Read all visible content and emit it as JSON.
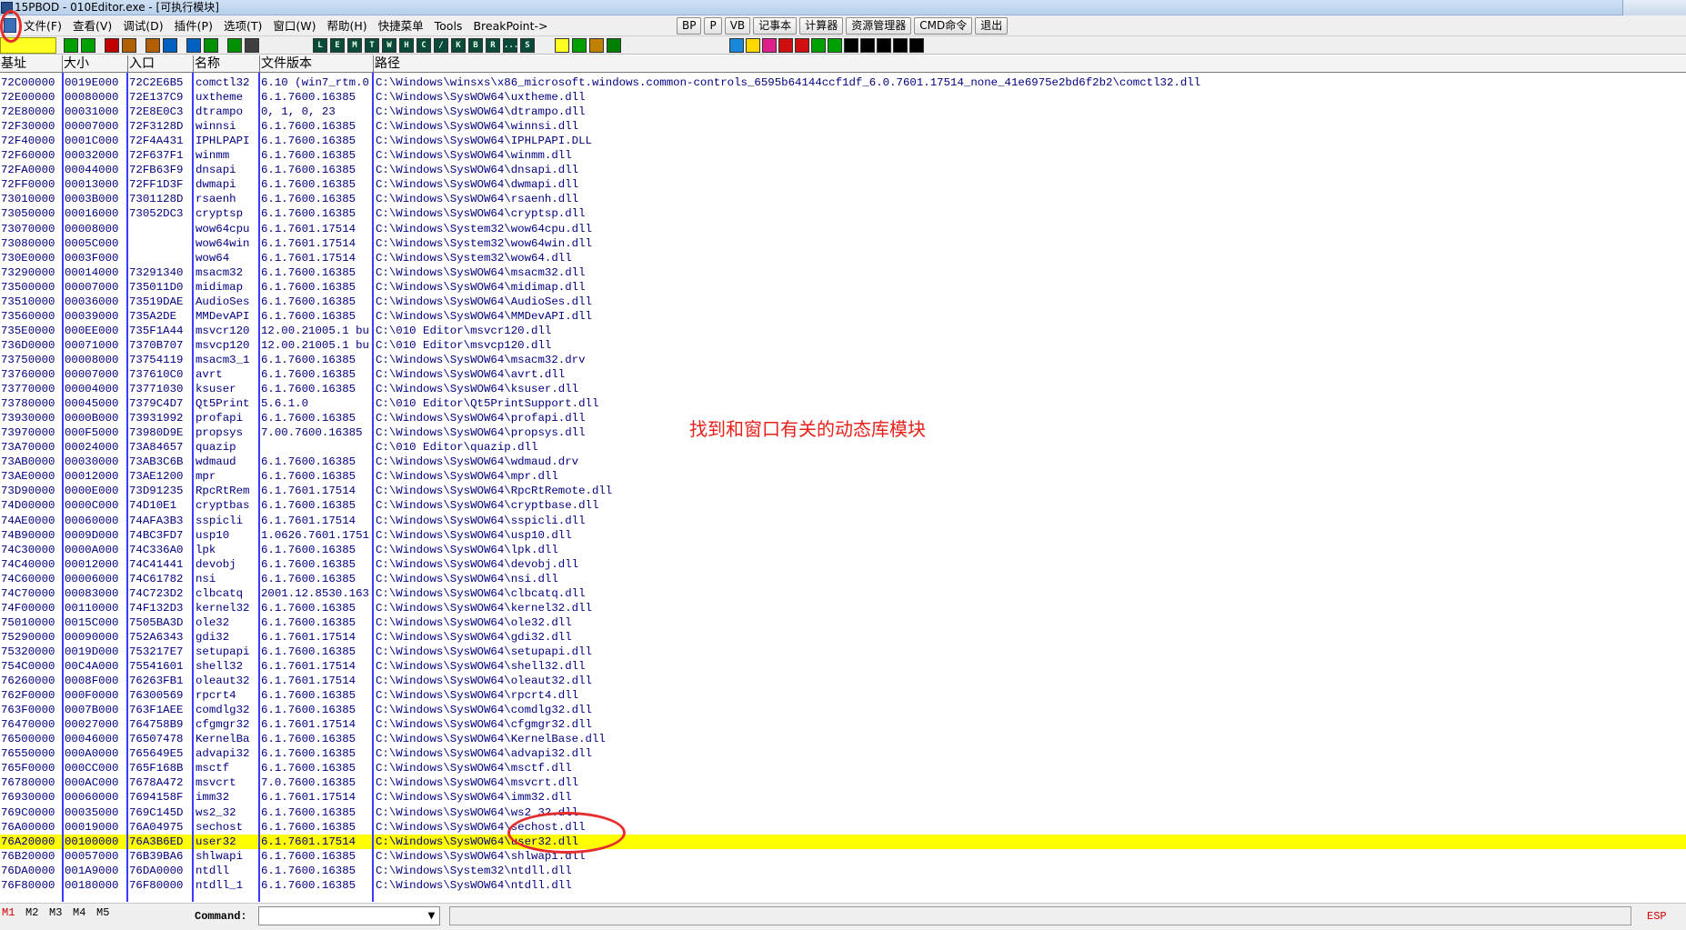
{
  "window": {
    "title": "15PBOD - 010Editor.exe - [可执行模块]"
  },
  "menu": {
    "items": [
      "文件(F)",
      "查看(V)",
      "调试(D)",
      "插件(P)",
      "选项(T)",
      "窗口(W)",
      "帮助(H)",
      "快捷菜单",
      "Tools",
      "BreakPoint->"
    ],
    "buttons": [
      "BP",
      "P",
      "VB",
      "记事本",
      "计算器",
      "资源管理器",
      "CMD命令",
      "退出"
    ]
  },
  "toolbar": {
    "letter_buttons": [
      "L",
      "E",
      "M",
      "T",
      "W",
      "H",
      "C",
      "/",
      "K",
      "B",
      "R",
      "...",
      "S"
    ]
  },
  "columns": [
    "基址",
    "大小",
    "入口",
    "名称",
    "文件版本",
    "路径"
  ],
  "rows": [
    [
      "72C00000",
      "0019E000",
      "72C2E6B5",
      "comctl32",
      "6.10 (win7_rtm.0",
      "C:\\Windows\\winsxs\\x86_microsoft.windows.common-controls_6595b64144ccf1df_6.0.7601.17514_none_41e6975e2bd6f2b2\\comctl32.dll"
    ],
    [
      "72E00000",
      "00080000",
      "72E137C9",
      "uxtheme",
      "6.1.7600.16385",
      "C:\\Windows\\SysWOW64\\uxtheme.dll"
    ],
    [
      "72E80000",
      "00031000",
      "72E8E0C3",
      "dtrampo",
      "0, 1, 0, 23",
      "C:\\Windows\\SysWOW64\\dtrampo.dll"
    ],
    [
      "72F30000",
      "00007000",
      "72F3128D",
      "winnsi",
      "6.1.7600.16385",
      "C:\\Windows\\SysWOW64\\winnsi.dll"
    ],
    [
      "72F40000",
      "0001C000",
      "72F4A431",
      "IPHLPAPI",
      "6.1.7600.16385",
      "C:\\Windows\\SysWOW64\\IPHLPAPI.DLL"
    ],
    [
      "72F60000",
      "00032000",
      "72F637F1",
      "winmm",
      "6.1.7600.16385",
      "C:\\Windows\\SysWOW64\\winmm.dll"
    ],
    [
      "72FA0000",
      "00044000",
      "72FB63F9",
      "dnsapi",
      "6.1.7600.16385",
      "C:\\Windows\\SysWOW64\\dnsapi.dll"
    ],
    [
      "72FF0000",
      "00013000",
      "72FF1D3F",
      "dwmapi",
      "6.1.7600.16385",
      "C:\\Windows\\SysWOW64\\dwmapi.dll"
    ],
    [
      "73010000",
      "0003B000",
      "7301128D",
      "rsaenh",
      "6.1.7600.16385",
      "C:\\Windows\\SysWOW64\\rsaenh.dll"
    ],
    [
      "73050000",
      "00016000",
      "73052DC3",
      "cryptsp",
      "6.1.7600.16385",
      "C:\\Windows\\SysWOW64\\cryptsp.dll"
    ],
    [
      "73070000",
      "00008000",
      "",
      "wow64cpu",
      "6.1.7601.17514",
      "C:\\Windows\\System32\\wow64cpu.dll"
    ],
    [
      "73080000",
      "0005C000",
      "",
      "wow64win",
      "6.1.7601.17514",
      "C:\\Windows\\System32\\wow64win.dll"
    ],
    [
      "730E0000",
      "0003F000",
      "",
      "wow64",
      "6.1.7601.17514",
      "C:\\Windows\\System32\\wow64.dll"
    ],
    [
      "73290000",
      "00014000",
      "73291340",
      "msacm32",
      "6.1.7600.16385",
      "C:\\Windows\\SysWOW64\\msacm32.dll"
    ],
    [
      "73500000",
      "00007000",
      "735011D0",
      "midimap",
      "6.1.7600.16385",
      "C:\\Windows\\SysWOW64\\midimap.dll"
    ],
    [
      "73510000",
      "00036000",
      "73519DAE",
      "AudioSes",
      "6.1.7600.16385",
      "C:\\Windows\\SysWOW64\\AudioSes.dll"
    ],
    [
      "73560000",
      "00039000",
      "735A2DE",
      "MMDevAPI",
      "6.1.7600.16385",
      "C:\\Windows\\SysWOW64\\MMDevAPI.dll"
    ],
    [
      "735E0000",
      "000EE000",
      "735F1A44",
      "msvcr120",
      "12.00.21005.1 bu",
      "C:\\010 Editor\\msvcr120.dll"
    ],
    [
      "736D0000",
      "00071000",
      "7370B707",
      "msvcp120",
      "12.00.21005.1 bu",
      "C:\\010 Editor\\msvcp120.dll"
    ],
    [
      "73750000",
      "00008000",
      "73754119",
      "msacm3_1",
      "6.1.7600.16385",
      "C:\\Windows\\SysWOW64\\msacm32.drv"
    ],
    [
      "73760000",
      "00007000",
      "737610C0",
      "avrt",
      "6.1.7600.16385",
      "C:\\Windows\\SysWOW64\\avrt.dll"
    ],
    [
      "73770000",
      "00004000",
      "73771030",
      "ksuser",
      "6.1.7600.16385",
      "C:\\Windows\\SysWOW64\\ksuser.dll"
    ],
    [
      "73780000",
      "00045000",
      "7379C4D7",
      "Qt5Print",
      "5.6.1.0",
      "C:\\010 Editor\\Qt5PrintSupport.dll"
    ],
    [
      "73930000",
      "0000B000",
      "73931992",
      "profapi",
      "6.1.7600.16385",
      "C:\\Windows\\SysWOW64\\profapi.dll"
    ],
    [
      "73970000",
      "000F5000",
      "73980D9E",
      "propsys",
      "7.00.7600.16385",
      "C:\\Windows\\SysWOW64\\propsys.dll"
    ],
    [
      "73A70000",
      "00024000",
      "73A84657",
      "quazip",
      "",
      "C:\\010 Editor\\quazip.dll"
    ],
    [
      "73AB0000",
      "00030000",
      "73AB3C6B",
      "wdmaud",
      "6.1.7600.16385",
      "C:\\Windows\\SysWOW64\\wdmaud.drv"
    ],
    [
      "73AE0000",
      "00012000",
      "73AE1200",
      "mpr",
      "6.1.7600.16385",
      "C:\\Windows\\SysWOW64\\mpr.dll"
    ],
    [
      "73D90000",
      "0000E000",
      "73D91235",
      "RpcRtRem",
      "6.1.7601.17514",
      "C:\\Windows\\SysWOW64\\RpcRtRemote.dll"
    ],
    [
      "74D00000",
      "0000C000",
      "74D10E1",
      "cryptbas",
      "6.1.7600.16385",
      "C:\\Windows\\SysWOW64\\cryptbase.dll"
    ],
    [
      "74AE0000",
      "00060000",
      "74AFA3B3",
      "sspicli",
      "6.1.7601.17514",
      "C:\\Windows\\SysWOW64\\sspicli.dll"
    ],
    [
      "74B90000",
      "0009D000",
      "74BC3FD7",
      "usp10",
      "1.0626.7601.1751",
      "C:\\Windows\\SysWOW64\\usp10.dll"
    ],
    [
      "74C30000",
      "0000A000",
      "74C336A0",
      "lpk",
      "6.1.7600.16385",
      "C:\\Windows\\SysWOW64\\lpk.dll"
    ],
    [
      "74C40000",
      "00012000",
      "74C41441",
      "devobj",
      "6.1.7600.16385",
      "C:\\Windows\\SysWOW64\\devobj.dll"
    ],
    [
      "74C60000",
      "00006000",
      "74C61782",
      "nsi",
      "6.1.7600.16385",
      "C:\\Windows\\SysWOW64\\nsi.dll"
    ],
    [
      "74C70000",
      "00083000",
      "74C723D2",
      "clbcatq",
      "2001.12.8530.163",
      "C:\\Windows\\SysWOW64\\clbcatq.dll"
    ],
    [
      "74F00000",
      "00110000",
      "74F132D3",
      "kernel32",
      "6.1.7600.16385",
      "C:\\Windows\\SysWOW64\\kernel32.dll"
    ],
    [
      "75010000",
      "0015C000",
      "7505BA3D",
      "ole32",
      "6.1.7600.16385",
      "C:\\Windows\\SysWOW64\\ole32.dll"
    ],
    [
      "75290000",
      "00090000",
      "752A6343",
      "gdi32",
      "6.1.7601.17514",
      "C:\\Windows\\SysWOW64\\gdi32.dll"
    ],
    [
      "75320000",
      "0019D000",
      "753217E7",
      "setupapi",
      "6.1.7600.16385",
      "C:\\Windows\\SysWOW64\\setupapi.dll"
    ],
    [
      "754C0000",
      "00C4A000",
      "75541601",
      "shell32",
      "6.1.7601.17514",
      "C:\\Windows\\SysWOW64\\shell32.dll"
    ],
    [
      "76260000",
      "0008F000",
      "76263FB1",
      "oleaut32",
      "6.1.7601.17514",
      "C:\\Windows\\SysWOW64\\oleaut32.dll"
    ],
    [
      "762F0000",
      "000F0000",
      "76300569",
      "rpcrt4",
      "6.1.7600.16385",
      "C:\\Windows\\SysWOW64\\rpcrt4.dll"
    ],
    [
      "763F0000",
      "0007B000",
      "763F1AEE",
      "comdlg32",
      "6.1.7600.16385",
      "C:\\Windows\\SysWOW64\\comdlg32.dll"
    ],
    [
      "76470000",
      "00027000",
      "764758B9",
      "cfgmgr32",
      "6.1.7601.17514",
      "C:\\Windows\\SysWOW64\\cfgmgr32.dll"
    ],
    [
      "76500000",
      "00046000",
      "76507478",
      "KernelBa",
      "6.1.7600.16385",
      "C:\\Windows\\SysWOW64\\KernelBase.dll"
    ],
    [
      "76550000",
      "000A0000",
      "765649E5",
      "advapi32",
      "6.1.7600.16385",
      "C:\\Windows\\SysWOW64\\advapi32.dll"
    ],
    [
      "765F0000",
      "000CC000",
      "765F168B",
      "msctf",
      "6.1.7600.16385",
      "C:\\Windows\\SysWOW64\\msctf.dll"
    ],
    [
      "76780000",
      "000AC000",
      "7678A472",
      "msvcrt",
      "7.0.7600.16385",
      "C:\\Windows\\SysWOW64\\msvcrt.dll"
    ],
    [
      "76930000",
      "00060000",
      "7694158F",
      "imm32",
      "6.1.7601.17514",
      "C:\\Windows\\SysWOW64\\imm32.dll"
    ],
    [
      "769C0000",
      "00035000",
      "769C145D",
      "ws2_32",
      "6.1.7600.16385",
      "C:\\Windows\\SysWOW64\\ws2_32.dll"
    ],
    [
      "76A00000",
      "00019000",
      "76A04975",
      "sechost",
      "6.1.7600.16385",
      "C:\\Windows\\SysWOW64\\sechost.dll"
    ],
    [
      "76A20000",
      "00100000",
      "76A3B6ED",
      "user32",
      "6.1.7601.17514",
      "C:\\Windows\\SysWOW64\\user32.dll"
    ],
    [
      "76B20000",
      "00057000",
      "76B39BA6",
      "shlwapi",
      "6.1.7600.16385",
      "C:\\Windows\\SysWOW64\\shlwapi.dll"
    ],
    [
      "76DA0000",
      "001A9000",
      "76DA0000",
      "ntdll",
      "6.1.7600.16385",
      "C:\\Windows\\System32\\ntdll.dll"
    ],
    [
      "76F80000",
      "00180000",
      "76F80000",
      "ntdll_1",
      "6.1.7600.16385",
      "C:\\Windows\\SysWOW64\\ntdll.dll"
    ]
  ],
  "selected_row": 52,
  "annotation": "找到和窗口有关的动态库模块",
  "statusbar": {
    "marks": [
      "M1",
      "M2",
      "M3",
      "M4",
      "M5"
    ],
    "command_label": "Command:",
    "register": "ESP"
  },
  "colors": {
    "selection": "#ffff00",
    "text": "#000080",
    "annotation": "#e8201a"
  }
}
